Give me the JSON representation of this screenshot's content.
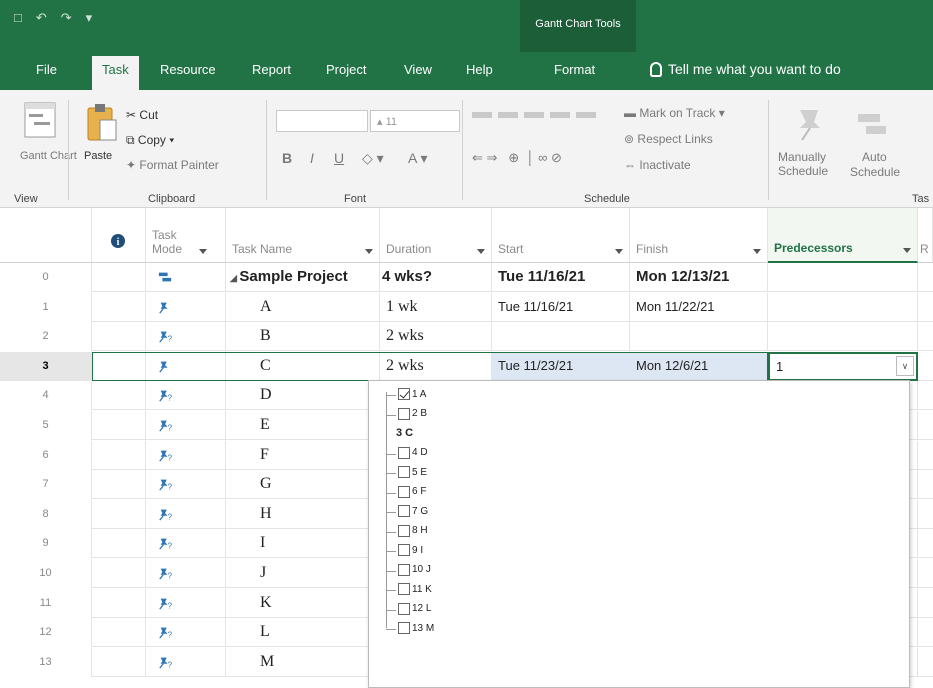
{
  "contextual_tab_group": "Gantt Chart Tools",
  "tabs": [
    "File",
    "Task",
    "Resource",
    "Report",
    "Project",
    "View",
    "Help",
    "Format"
  ],
  "tell_me": "Tell me what you want to do",
  "ribbon": {
    "view_btn": "Gantt\nChart",
    "view_group": "View",
    "paste": "Paste",
    "cut": "Cut",
    "copy": "Copy",
    "format_painter": "Format Painter",
    "clipboard_group": "Clipboard",
    "font_size": "11",
    "font_group": "Font",
    "mark_on_track": "Mark on Track",
    "respect_links": "Respect Links",
    "inactivate": "Inactivate",
    "schedule_group": "Schedule",
    "manually": "Manually",
    "auto": "Auto",
    "schedule": "Schedule",
    "tasks_group": "Tas"
  },
  "columns": {
    "info": "i",
    "task_mode": "Task\nMode",
    "task_name": "Task Name",
    "duration": "Duration",
    "start": "Start",
    "finish": "Finish",
    "predecessors": "Predecessors",
    "next": "R"
  },
  "rows": [
    {
      "num": "0",
      "name": "Sample Project",
      "duration": "4 wks?",
      "start": "Tue 11/16/21",
      "finish": "Mon 12/13/21",
      "pred": "",
      "mode": "auto"
    },
    {
      "num": "1",
      "name": "A",
      "duration": "1 wk",
      "start": "Tue 11/16/21",
      "finish": "Mon 11/22/21",
      "pred": "",
      "mode": "manual"
    },
    {
      "num": "2",
      "name": "B",
      "duration": "2 wks",
      "start": "",
      "finish": "",
      "pred": "",
      "mode": "manual-q"
    },
    {
      "num": "3",
      "name": "C",
      "duration": "2 wks",
      "start": "Tue 11/23/21",
      "finish": "Mon 12/6/21",
      "pred": "1",
      "mode": "manual"
    },
    {
      "num": "4",
      "name": "D",
      "duration": "",
      "start": "",
      "finish": "",
      "pred": "",
      "mode": "manual-q"
    },
    {
      "num": "5",
      "name": "E",
      "duration": "",
      "start": "",
      "finish": "",
      "pred": "",
      "mode": "manual-q"
    },
    {
      "num": "6",
      "name": "F",
      "duration": "",
      "start": "",
      "finish": "",
      "pred": "",
      "mode": "manual-q"
    },
    {
      "num": "7",
      "name": "G",
      "duration": "",
      "start": "",
      "finish": "",
      "pred": "",
      "mode": "manual-q"
    },
    {
      "num": "8",
      "name": "H",
      "duration": "",
      "start": "",
      "finish": "",
      "pred": "",
      "mode": "manual-q"
    },
    {
      "num": "9",
      "name": "I",
      "duration": "",
      "start": "",
      "finish": "",
      "pred": "",
      "mode": "manual-q"
    },
    {
      "num": "10",
      "name": "J",
      "duration": "",
      "start": "",
      "finish": "",
      "pred": "",
      "mode": "manual-q"
    },
    {
      "num": "11",
      "name": "K",
      "duration": "",
      "start": "",
      "finish": "",
      "pred": "",
      "mode": "manual-q"
    },
    {
      "num": "12",
      "name": "L",
      "duration": "",
      "start": "",
      "finish": "",
      "pred": "",
      "mode": "manual-q"
    },
    {
      "num": "13",
      "name": "M",
      "duration": "",
      "start": "",
      "finish": "",
      "pred": "",
      "mode": "manual-q"
    }
  ],
  "dropdown_items": [
    {
      "label": "1 A",
      "checked": true,
      "current": false
    },
    {
      "label": "2 B",
      "checked": false,
      "current": false
    },
    {
      "label": "3 C",
      "checked": false,
      "current": true
    },
    {
      "label": "4 D",
      "checked": false,
      "current": false
    },
    {
      "label": "5 E",
      "checked": false,
      "current": false
    },
    {
      "label": "6 F",
      "checked": false,
      "current": false
    },
    {
      "label": "7 G",
      "checked": false,
      "current": false
    },
    {
      "label": "8 H",
      "checked": false,
      "current": false
    },
    {
      "label": "9 I",
      "checked": false,
      "current": false
    },
    {
      "label": "10 J",
      "checked": false,
      "current": false
    },
    {
      "label": "11 K",
      "checked": false,
      "current": false
    },
    {
      "label": "12 L",
      "checked": false,
      "current": false
    },
    {
      "label": "13 M",
      "checked": false,
      "current": false
    }
  ],
  "colors": {
    "accent": "#217346",
    "contextual": "#1b5e38",
    "manual_pin": "#2e75b6"
  }
}
